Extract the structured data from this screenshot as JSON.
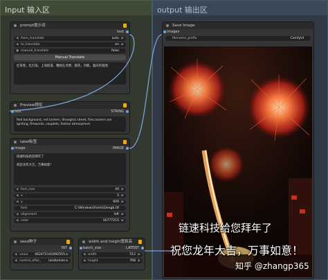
{
  "groups": {
    "input_title": "Input 输入区",
    "output_title": "output 输出区"
  },
  "prompt_node": {
    "title": "prompt提示词",
    "output_label": "text",
    "from_translate_label": "from_translate",
    "from_translate_value": "auto",
    "to_translate_label": "to_translate",
    "to_translate_value": "en",
    "manual_translate_label": "manual_translate",
    "manual_translate_value": "false",
    "button_label": "Manual Translate",
    "text": "红背景，红灯笼，上海街道，鞭炮在点燃，烟花，对联，喜庆的氛围"
  },
  "preview_node": {
    "title": "Preview预览",
    "input_label": "text",
    "output_label": "STRING",
    "text": "Red background, red lantern, Shanghai street, firecrackers are igniting, fireworks, couplets, festive atmosphere"
  },
  "label_node": {
    "title": "label标签",
    "input_label": "image",
    "output_label": "IMAGE",
    "text": "链速科技给您拜年了\n\n祝您龙年大吉，万事如意！",
    "widgets": [
      {
        "label": "font_size",
        "value": "40"
      },
      {
        "label": "x",
        "value": "5"
      },
      {
        "label": "y",
        "value": "600"
      },
      {
        "label": "font",
        "value": "C:\\Windows\\Fonts\\Dengb.ttf"
      },
      {
        "label": "alignment",
        "value": "left"
      },
      {
        "label": "color",
        "value": "16777215"
      }
    ]
  },
  "seed_node": {
    "title": "seed种子",
    "output_label": "INT",
    "value_label": "value",
    "value": "462472141092555",
    "control_label": "control_after_",
    "control_value": "randomize"
  },
  "size_node": {
    "title": "width and height宽和高",
    "input_label": "batch_size",
    "output_label": "LATENT",
    "width_label": "width",
    "width_value": "512",
    "height_label": "height",
    "height_value": "768"
  },
  "save_node": {
    "title": "Save Image",
    "input_label": "images",
    "prefix_label": "filename_prefix",
    "prefix_value": "ComfyUI"
  },
  "image_overlay": {
    "line1": "链速科技给您拜年了",
    "line2": "祝您龙年大吉，万事如意！",
    "watermark": "知乎 @zhangp365"
  },
  "colors": {
    "input_group": "#33392f",
    "output_group": "#313a44",
    "link": "#7aa3d8",
    "lock": "#e0b020"
  }
}
